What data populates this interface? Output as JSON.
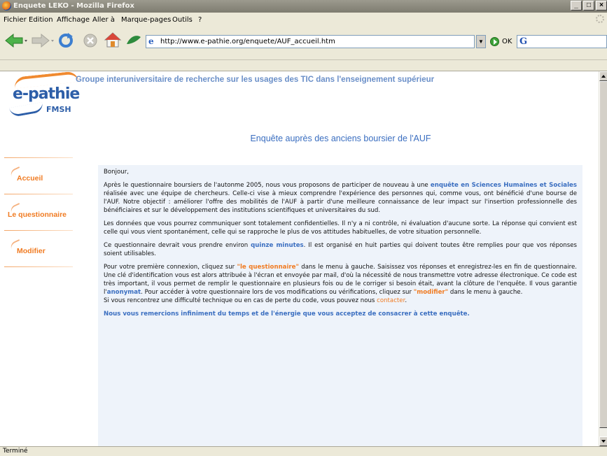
{
  "window": {
    "title": "Enquete LEKO - Mozilla Firefox",
    "controls": [
      "_",
      "□",
      "×"
    ]
  },
  "menu": [
    {
      "label": "Fichier",
      "key": "F"
    },
    {
      "label": "Edition",
      "key": "E"
    },
    {
      "label": "Affichage",
      "key": "A"
    },
    {
      "label": "Aller à",
      "key": ""
    },
    {
      "label": "Marque-pages",
      "key": "M"
    },
    {
      "label": "Outils",
      "key": "i"
    },
    {
      "label": "?",
      "key": "?"
    }
  ],
  "navbar": {
    "url": "http://www.e-pathie.org/enquete/AUF_accueil.htm",
    "go_label": "OK",
    "search_logo": "G"
  },
  "page": {
    "logo_brand": "e-pathie",
    "logo_sub": "FMSH",
    "group_title": "Groupe interuniversitaire de recherche sur les usages des TIC dans l'enseignement supérieur",
    "title": "Enquête auprès des anciens boursier de l'AUF",
    "side_menu": [
      "Accueil",
      "Le questionnaire",
      "Modifier"
    ],
    "body": {
      "greeting": "Bonjour,",
      "p1_a": "Après le questionnaire boursiers de l'autonme 2005, nous vous proposons de participer de nouveau à une ",
      "p1_link": "enquête en Sciences Humaines et Sociales",
      "p1_b": " réalisée avec une équipe de chercheurs. Celle-ci vise à mieux comprendre l'expérience des personnes qui, comme vous, ont bénéficié d'une bourse de l'AUF. Notre objectif : améliorer l'offre des mobilités de l'AUF à partir d'une meilleure connaissance de leur impact sur l'insertion professionnelle des bénéficiaires et sur le développement des institutions scientifiques et universitaires du sud.",
      "p2": "Les données que vous pourrez communiquer sont totalement confidentielles. Il n'y a ni contrôle, ni évaluation d'aucune sorte. La réponse qui convient est celle qui vous vient spontanément, celle qui se rapproche le plus de vos attitudes habituelles, de votre situation personnelle.",
      "p3_a": "Ce questionnaire devrait vous prendre environ ",
      "p3_link": "quinze minutes",
      "p3_b": ". Il est organisé en huit parties qui doivent toutes être remplies pour que vos réponses soient utilisables.",
      "p4_a": "Pour votre première connexion, cliquez sur ",
      "p4_q": "\"le questionnaire\"",
      "p4_b": " dans le menu à gauche. Saisissez vos réponses et enregistrez-les en fin de questionnaire. Une clé d'identification vous est alors attribuée à l'écran et envoyée par mail, d'où la nécessité de nous transmettre votre adresse électronique. Ce code est très important, il vous permet de remplir le questionnaire en plusieurs fois ou de le corriger si besoin était, avant la clôture de l'enquête. Il vous garantie l'",
      "p4_anon": "anonymat",
      "p4_c": ". Pour accéder à votre questionnaire lors de vos modifications ou vérifications, cliquez sur ",
      "p4_mod": "\"modifier\"",
      "p4_d": " dans le menu à gauche.",
      "p4_e": "Si vous rencontrez une difficulté technique ou en cas de perte du code, vous pouvez nous ",
      "p4_contact": "contacter",
      "p4_f": ".",
      "thanks": "Nous vous remercions infiniment du temps et de l'énergie que vous acceptez de consacrer à cette enquête."
    }
  },
  "status": "Terminé",
  "colors": {
    "accent_blue": "#3a6ec0",
    "accent_orange": "#f07b22",
    "panel_bg": "#eef3fa"
  }
}
